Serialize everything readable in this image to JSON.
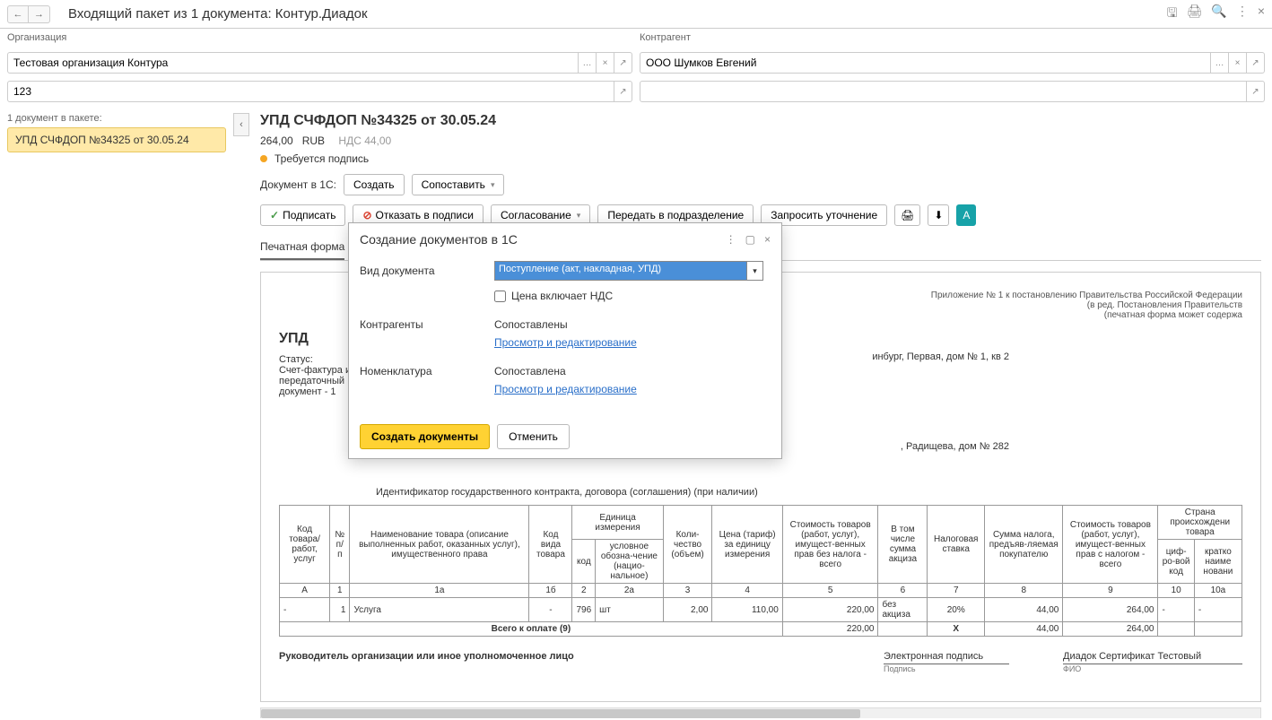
{
  "title": "Входящий пакет из 1 документа: Контур.Диадок",
  "org": {
    "label": "Организация",
    "value": "Тестовая организация Контура",
    "second_value": "123"
  },
  "counterparty": {
    "label": "Контрагент",
    "value": "ООО Шумков Евгений"
  },
  "packet": {
    "count_label": "1 документ в пакете:",
    "items": [
      "УПД СЧФДОП №34325 от 30.05.24"
    ]
  },
  "doc": {
    "title": "УПД СЧФДОП №34325 от 30.05.24",
    "amount": "264,00",
    "currency": "RUB",
    "nds": "НДС 44,00",
    "status": "Требуется подпись",
    "in1c_label": "Документ в 1С:",
    "btn_create": "Создать",
    "btn_match": "Сопоставить"
  },
  "actions": {
    "sign": "Подписать",
    "refuse": "Отказать в подписи",
    "approval": "Согласование",
    "forward": "Передать в подразделение",
    "request": "Запросить уточнение"
  },
  "tabs": {
    "print": "Печатная форма"
  },
  "preview": {
    "annex1": "Приложение № 1 к постановлению Правительства Российской Федерации",
    "annex2": "(в ред. Постановления Правительств",
    "annex3": "(печатная форма может содержа",
    "upd": "УПД",
    "status_label": "Статус:",
    "sf_line": "Счет-фактура и",
    "pd_line1": "передаточный",
    "pd_line2": "документ - 1",
    "addr_frag1": "инбург, Первая, дом № 1, кв 2",
    "addr_frag2": ", Радищева, дом № 282",
    "contract_id": "Идентификатор государственного контракта, договора (соглашения) (при наличии)",
    "headers": {
      "code": "Код товара/ работ, услуг",
      "num": "№ п/п",
      "name": "Наименование товара (описание выполненных работ, оказанных услуг), имущественного права",
      "kind": "Код вида товара",
      "unit": "Единица измерения",
      "unit_code": "код",
      "unit_name": "условное обозна-чение (нацио-нальное)",
      "qty": "Коли-чество (объем)",
      "price": "Цена (тариф) за единицу измерения",
      "cost": "Стоимость товаров (работ, услуг), имущест-венных прав без налога - всего",
      "excise": "В том числе сумма акциза",
      "rate": "Налоговая ставка",
      "tax": "Сумма налога, предъяв-ляемая покупателю",
      "total": "Стоимость товаров (работ, услуг), имущест-венных прав с налогом - всего",
      "country": "Страна происхождени товара",
      "digit_code": "циф-ро-вой код",
      "short_name": "кратко наиме новани"
    },
    "colnums": {
      "A": "А",
      "c1": "1",
      "c1a": "1а",
      "c1b": "1б",
      "c2": "2",
      "c2a": "2а",
      "c3": "3",
      "c4": "4",
      "c5": "5",
      "c6": "6",
      "c7": "7",
      "c8": "8",
      "c9": "9",
      "c10": "10",
      "c10a": "10а"
    },
    "row": {
      "code": "-",
      "num": "1",
      "name": "Услуга",
      "kind": "-",
      "unit_code": "796",
      "unit_name": "шт",
      "qty": "2,00",
      "price": "110,00",
      "cost": "220,00",
      "excise": "без акциза",
      "rate": "20%",
      "tax": "44,00",
      "total": "264,00",
      "dc": "-",
      "sn": "-"
    },
    "totals": {
      "label": "Всего к оплате (9)",
      "cost": "220,00",
      "x": "X",
      "tax": "44,00",
      "total": "264,00"
    },
    "sign": {
      "head": "Руководитель организации или иное уполномоченное лицо",
      "esign": "Электронная подпись",
      "esign_sub": "Подпись",
      "cert": "Диадок Сертификат Тестовый",
      "cert_sub": "ФИО"
    }
  },
  "modal": {
    "title": "Создание документов в 1С",
    "doc_type_label": "Вид документа",
    "doc_type_value": "Поступление (акт, накладная, УПД)",
    "price_includes_vat": "Цена включает НДС",
    "counterparties_label": "Контрагенты",
    "matched": "Сопоставлены",
    "matched_f": "Сопоставлена",
    "view_edit": "Просмотр и редактирование",
    "nomenclature_label": "Номенклатура",
    "create_btn": "Создать документы",
    "cancel_btn": "Отменить"
  }
}
